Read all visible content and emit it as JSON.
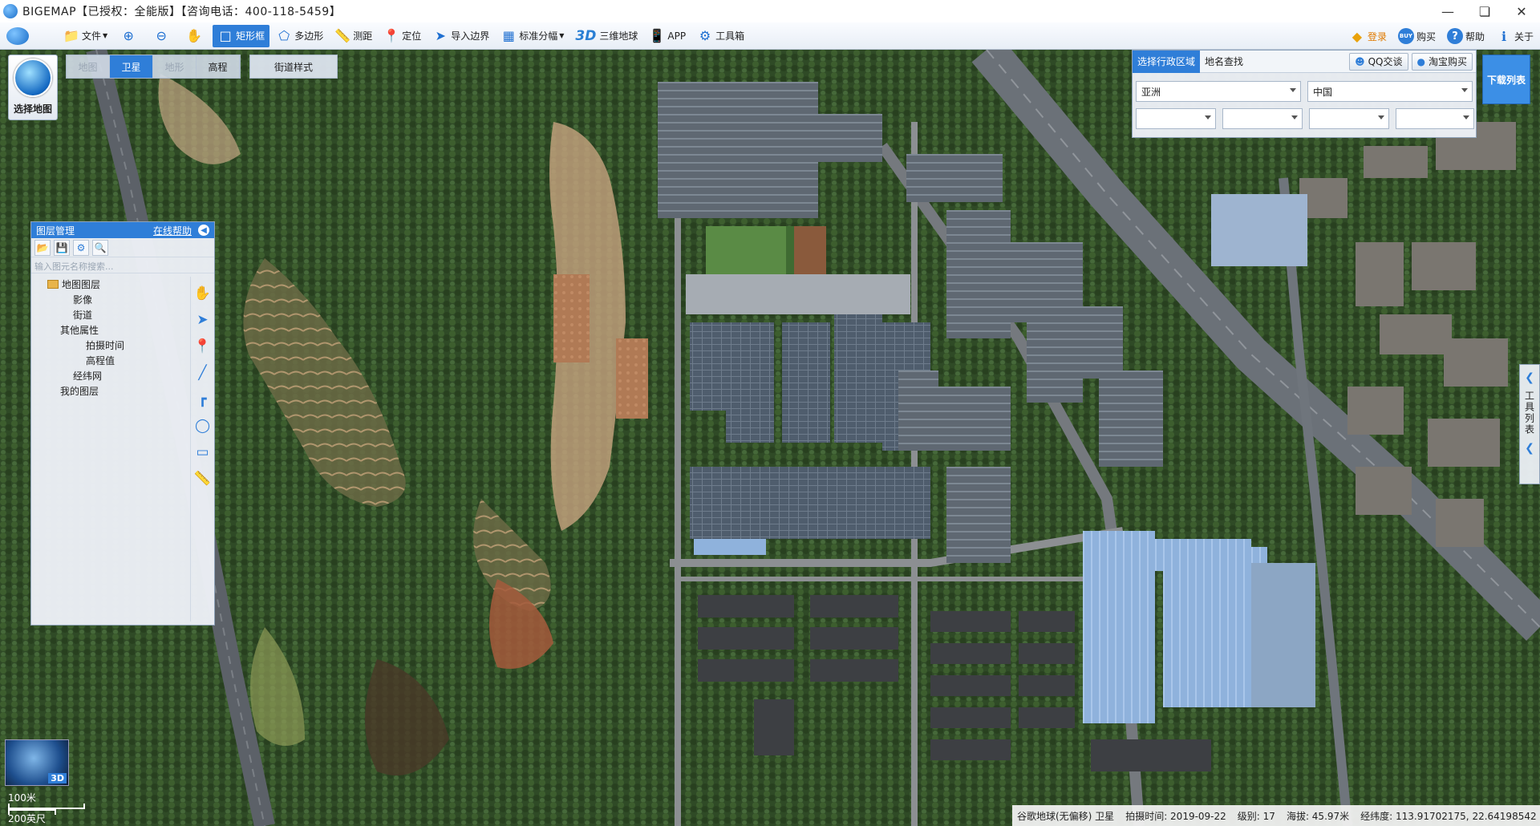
{
  "app": {
    "title": "BIGEMAP【已授权：全能版】【咨询电话：400-118-5459】",
    "window_controls": [
      "minimize",
      "restore",
      "close"
    ]
  },
  "toolbar": {
    "items": [
      {
        "label": "文件",
        "icon": "folder-icon",
        "dropdown": true
      },
      {
        "label": "",
        "icon": "zoom-in-icon"
      },
      {
        "label": "",
        "icon": "zoom-out-icon"
      },
      {
        "label": "",
        "icon": "hand-icon"
      },
      {
        "label": "矩形框",
        "icon": "rectangle-select-icon",
        "active": true
      },
      {
        "label": "多边形",
        "icon": "polygon-icon"
      },
      {
        "label": "测距",
        "icon": "ruler-icon"
      },
      {
        "label": "定位",
        "icon": "location-pin-icon"
      },
      {
        "label": "导入边界",
        "icon": "import-icon"
      },
      {
        "label": "标准分幅",
        "icon": "grid-icon",
        "dropdown": true
      },
      {
        "label": "三维地球",
        "icon": "3d-icon"
      },
      {
        "label": "APP",
        "icon": "phone-icon"
      },
      {
        "label": "工具箱",
        "icon": "gear-icon"
      }
    ],
    "right_items": [
      {
        "label": "登录",
        "icon": "diamond-icon"
      },
      {
        "label": "购买",
        "icon": "buy-icon"
      },
      {
        "label": "帮助",
        "icon": "help-icon"
      },
      {
        "label": "关于",
        "icon": "info-icon"
      }
    ],
    "icon_3d_text": "3D",
    "buy_icon_text": "BUY"
  },
  "map": {
    "select_map_label": "选择地图",
    "tabs": [
      {
        "label": "地图",
        "state": "disabled"
      },
      {
        "label": "卫星",
        "state": "active"
      },
      {
        "label": "地形",
        "state": "disabled"
      },
      {
        "label": "高程",
        "state": "enabled"
      }
    ],
    "street_style_label": "街道样式",
    "download_list_label": "下载列表",
    "tool_list_label": "工具列表"
  },
  "layer_panel": {
    "title": "图层管理",
    "help_link": "在线帮助",
    "search_placeholder": "输入图元名称搜索...",
    "tree": [
      {
        "label": "地图图层",
        "indent": 0,
        "folder": true
      },
      {
        "label": "影像",
        "indent": 2,
        "folder": false
      },
      {
        "label": "街道",
        "indent": 2,
        "folder": false
      },
      {
        "label": "其他属性",
        "indent": 1,
        "folder": false
      },
      {
        "label": "拍摄时间",
        "indent": 3,
        "folder": false
      },
      {
        "label": "高程值",
        "indent": 3,
        "folder": false
      },
      {
        "label": "经纬网",
        "indent": 2,
        "folder": false
      },
      {
        "label": "我的图层",
        "indent": 1,
        "folder": false
      }
    ],
    "side_tools": [
      "hand-icon",
      "arrow-pointer-icon",
      "marker-icon",
      "line-icon",
      "polyline-icon",
      "circle-icon",
      "rectangle-icon",
      "ruler-icon"
    ]
  },
  "region_panel": {
    "tabs": [
      {
        "label": "选择行政区域",
        "active": true
      },
      {
        "label": "地名查找",
        "active": false
      }
    ],
    "qq_button": "QQ交谈",
    "taobao_button": "淘宝购买",
    "continent": "亚洲",
    "country": "中国",
    "province": "",
    "city": "",
    "district": "",
    "town": ""
  },
  "overview": {
    "badge": "3D"
  },
  "scale": {
    "metric": "100米",
    "imperial": "200英尺"
  },
  "status": {
    "source": "谷歌地球(无偏移) 卫星",
    "date_label": "拍摄时间: 2019-09-22",
    "level_label": "级别:  17",
    "elevation_label": "海拔: 45.97米",
    "coords_label": "经纬度:   113.91702175, 22.64198542"
  },
  "colors": {
    "accent": "#2f7ed8",
    "toolbar_bg": "#e8eef6"
  }
}
